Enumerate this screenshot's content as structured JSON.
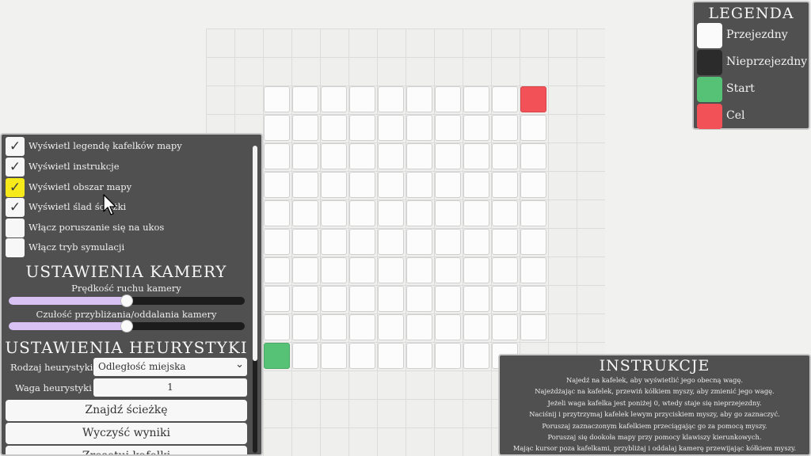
{
  "map": {
    "columns": 10,
    "rows": 10,
    "start_tile": {
      "col": 0,
      "row": 9
    },
    "goal_tile": {
      "col": 9,
      "row": 0
    },
    "missing_tiles": [
      {
        "col": 9,
        "row": 9
      }
    ]
  },
  "legend": {
    "title": "LEGENDA",
    "items": [
      {
        "label": "Przejezdny",
        "color": "#fbfbfb"
      },
      {
        "label": "Nieprzejezdny",
        "color": "#2b2b2b"
      },
      {
        "label": "Start",
        "color": "#55c275"
      },
      {
        "label": "Cel",
        "color": "#f25257"
      }
    ]
  },
  "options": {
    "checkboxes": [
      {
        "label": "Wyświetl legendę kafelków mapy",
        "checked": true,
        "highlight": false
      },
      {
        "label": "Wyświetl instrukcje",
        "checked": true,
        "highlight": false
      },
      {
        "label": "Wyświetl obszar mapy",
        "checked": true,
        "highlight": true
      },
      {
        "label": "Wyświetl ślad ścieżki",
        "checked": true,
        "highlight": false
      },
      {
        "label": "Włącz poruszanie się na ukos",
        "checked": false,
        "highlight": false
      },
      {
        "label": "Włącz tryb symulacji",
        "checked": false,
        "highlight": false
      }
    ],
    "camera": {
      "title": "USTAWIENIA KAMERY",
      "move_speed_label": "Prędkość ruchu kamery",
      "move_speed_value": 0.5,
      "zoom_sensitivity_label": "Czułość przybliżania/oddalania kamery",
      "zoom_sensitivity_value": 0.5
    },
    "heuristic": {
      "title": "USTAWIENIA HEURYSTYKI",
      "type_label": "Rodzaj heurystyki",
      "type_value": "Odległość miejska",
      "weight_label": "Waga heurystyki",
      "weight_value": "1"
    },
    "buttons": {
      "find_path": "Znajdź ścieżkę",
      "clear_results": "Wyczyść wyniki",
      "partial": "Zresetuj kafelki"
    },
    "accent_checked_highlight": "#f6ea1a",
    "slider_fill_color": "#d8c2f3"
  },
  "instructions": {
    "title": "INSTRUKCJE",
    "lines": [
      "Najedź na kafelek, aby wyświetlić jego obecną wagę.",
      "Najeżdżając na kafelek, przewiń kółkiem myszy, aby zmienić jego wagę.",
      "Jeżeli waga kafelka jest poniżej 0, wtedy staje się nieprzejezdny.",
      "Naciśnij i przytrzymaj kafelek lewym przyciskiem myszy, aby go zaznaczyć.",
      "Poruszaj zaznaczonym kafelkiem przeciągając go za pomocą myszy.",
      "Poruszaj się dookoła mapy przy pomocy klawiszy kierunkowych.",
      "Mając kursor poza kafelkami, przybliżaj i oddalaj kamerę przewijając kółkiem myszy."
    ]
  }
}
